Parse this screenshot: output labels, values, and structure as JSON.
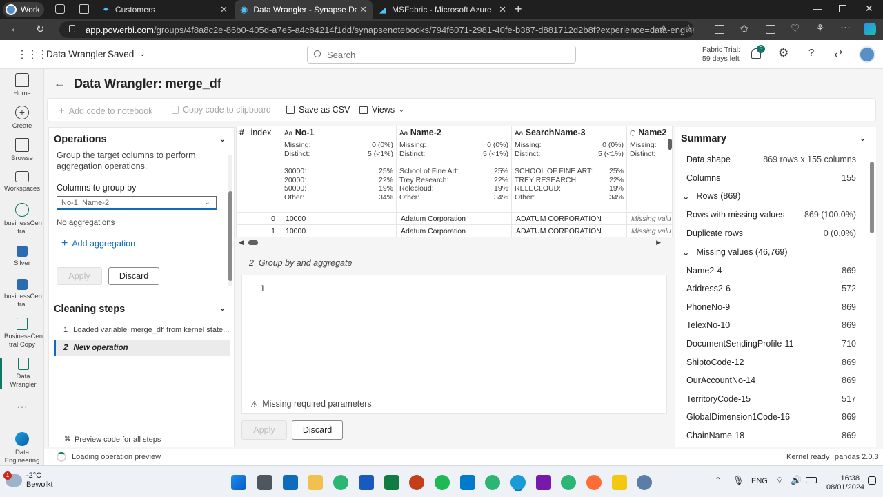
{
  "browser": {
    "tabs": [
      {
        "label": "Customers"
      },
      {
        "label": "Data Wrangler - Synapse Data En"
      },
      {
        "label": "MSFabric - Microsoft Azure"
      }
    ],
    "profile": "Work",
    "url_host": "app.powerbi.com",
    "url_path": "/groups/4f8a8c2e-86b0-405d-a7e5-a4c84214f1dd/synapsenotebooks/794f6071-2981-40fe-b387-d881712d2b8f?experience=data-engineering"
  },
  "app": {
    "name": "Data Wrangler",
    "saved": "Saved",
    "search_placeholder": "Search",
    "trial_line1": "Fabric Trial:",
    "trial_line2": "59 days left",
    "notif_count": "5"
  },
  "rail": [
    {
      "label": "Home"
    },
    {
      "label": "Create"
    },
    {
      "label": "Browse"
    },
    {
      "label": "Workspaces"
    },
    {
      "label": "businessCen tral"
    },
    {
      "label": "Silver"
    },
    {
      "label": "businessCen tral"
    },
    {
      "label": "BusinessCen tral Copy"
    },
    {
      "label": "Data Wrangler"
    },
    {
      "label": "Data Engineering"
    }
  ],
  "page": {
    "title": "Data Wrangler: merge_df"
  },
  "toolbar": {
    "add_code": "Add code to notebook",
    "copy_code": "Copy code to clipboard",
    "save_csv": "Save as CSV",
    "views": "Views"
  },
  "operations": {
    "heading": "Operations",
    "description": "Group the target columns to perform aggregation operations.",
    "group_label": "Columns to group by",
    "group_value": "No-1, Name-2",
    "no_agg": "No aggregations",
    "add_agg": "Add aggregation",
    "apply": "Apply",
    "discard": "Discard"
  },
  "cleaning": {
    "heading": "Cleaning steps",
    "steps": [
      {
        "num": "1",
        "label": "Loaded variable 'merge_df' from kernel state..."
      },
      {
        "num": "2",
        "label": "New operation"
      }
    ],
    "preview": "Preview code for all steps"
  },
  "grid": {
    "index_header": "index",
    "columns": [
      {
        "name": "No-1",
        "missing": "0 (0%)",
        "distinct": "5 (<1%)",
        "top": [
          [
            "30000:",
            "25%"
          ],
          [
            "20000:",
            "22%"
          ],
          [
            "50000:",
            "19%"
          ],
          [
            "Other:",
            "34%"
          ]
        ],
        "rows": [
          "10000",
          "10000"
        ]
      },
      {
        "name": "Name-2",
        "missing": "0 (0%)",
        "distinct": "5 (<1%)",
        "top": [
          [
            "School of Fine Art:",
            "25%"
          ],
          [
            "Trey Research:",
            "22%"
          ],
          [
            "Relecloud:",
            "19%"
          ],
          [
            "Other:",
            "34%"
          ]
        ],
        "rows": [
          "Adatum Corporation",
          "Adatum Corporation"
        ]
      },
      {
        "name": "SearchName-3",
        "missing": "0 (0%)",
        "distinct": "5 (<1%)",
        "top": [
          [
            "SCHOOL OF FINE ART:",
            "25%"
          ],
          [
            "TREY RESEARCH:",
            "22%"
          ],
          [
            "RELECLOUD:",
            "19%"
          ],
          [
            "Other:",
            "34%"
          ]
        ],
        "rows": [
          "ADATUM CORPORATION",
          "ADATUM CORPORATION"
        ]
      },
      {
        "name": "Name2",
        "missing": "",
        "distinct": "",
        "top": [],
        "rows": [
          "Missing valu",
          "Missing valu"
        ]
      }
    ],
    "missing_label": "Missing:",
    "distinct_label": "Distinct:",
    "index_values": [
      "0",
      "1"
    ]
  },
  "code": {
    "step_title": "2  Group by and aggregate",
    "line_no": "1",
    "warning": "Missing required parameters",
    "apply": "Apply",
    "discard": "Discard"
  },
  "summary": {
    "heading": "Summary",
    "shape_label": "Data shape",
    "shape_value": "869 rows x 155 columns",
    "columns_label": "Columns",
    "columns_value": "155",
    "rows_section": "Rows (869)",
    "missing_rows_label": "Rows with missing values",
    "missing_rows_value": "869 (100.0%)",
    "dup_label": "Duplicate rows",
    "dup_value": "0 (0.0%)",
    "missing_section": "Missing values (46,769)",
    "missing_list": [
      {
        "name": "Name2-4",
        "value": "869"
      },
      {
        "name": "Address2-6",
        "value": "572"
      },
      {
        "name": "PhoneNo-9",
        "value": "869"
      },
      {
        "name": "TelexNo-10",
        "value": "869"
      },
      {
        "name": "DocumentSendingProfile-11",
        "value": "710"
      },
      {
        "name": "ShiptoCode-12",
        "value": "869"
      },
      {
        "name": "OurAccountNo-14",
        "value": "869"
      },
      {
        "name": "TerritoryCode-15",
        "value": "517"
      },
      {
        "name": "GlobalDimension1Code-16",
        "value": "869"
      },
      {
        "name": "ChainName-18",
        "value": "869"
      }
    ]
  },
  "status": {
    "loading": "Loading operation preview",
    "kernel": "Kernel ready",
    "pandas": "pandas 2.0.3"
  },
  "taskbar": {
    "weather_temp": "-2°C",
    "weather_desc": "Bewolkt",
    "weather_badge": "1",
    "lang": "ENG",
    "time": "16:38",
    "date": "08/01/2024"
  },
  "colors": {
    "accent": "#117865",
    "link": "#0f6cbd"
  }
}
